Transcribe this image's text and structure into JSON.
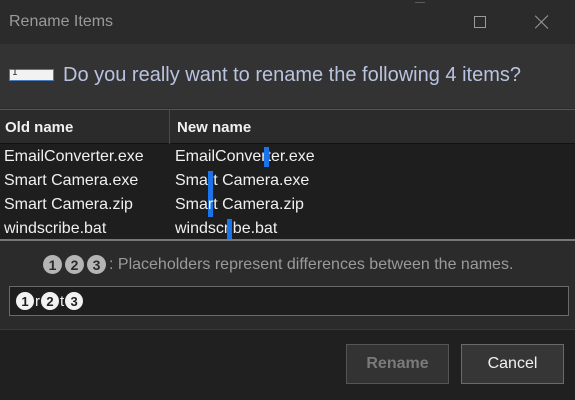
{
  "window": {
    "title": "Rename Items"
  },
  "question": {
    "text": "Do you really want to rename the following 4 items?"
  },
  "table": {
    "headers": [
      "Old name",
      "New name"
    ],
    "rows": [
      {
        "old": "EmailConverter.exe",
        "new": "EmailConverter.exe"
      },
      {
        "old": "Smart Camera.exe",
        "new": "Smart Camera.exe"
      },
      {
        "old": "Smart Camera.zip",
        "new": "Smart Camera.zip"
      },
      {
        "old": "windscribe.bat",
        "new": "windscribe.bat"
      }
    ]
  },
  "hint": {
    "placeholders": [
      "1",
      "2",
      "3"
    ],
    "text": ": Placeholders represent differences between the names."
  },
  "pattern": {
    "tokens": [
      {
        "kind": "placeholder",
        "text": "1"
      },
      {
        "kind": "literal",
        "text": "r"
      },
      {
        "kind": "placeholder",
        "text": "2"
      },
      {
        "kind": "literal",
        "text": "t"
      },
      {
        "kind": "placeholder",
        "text": "3"
      }
    ]
  },
  "footer": {
    "rename_label": "Rename",
    "cancel_label": "Cancel"
  },
  "colors": {
    "accent": "#1a73e8",
    "background": "#2b2b2b"
  },
  "icons": [
    "minimize-icon",
    "maximize-icon",
    "close-icon",
    "rename-textbox-icon"
  ]
}
